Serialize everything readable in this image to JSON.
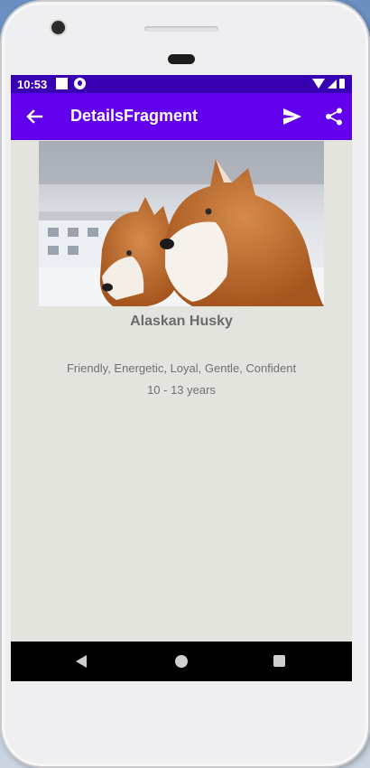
{
  "status_bar": {
    "time": "10:53"
  },
  "app_bar": {
    "title": "DetailsFragment",
    "color": "#6200ee",
    "status_color": "#3700b3"
  },
  "dog": {
    "name": "Alaskan Husky",
    "temperament": "Friendly, Energetic, Loyal, Gentle, Confident",
    "life_span": "10 - 13 years"
  },
  "icons": {
    "back": "arrow-back-icon",
    "send": "send-icon",
    "share": "share-icon"
  }
}
